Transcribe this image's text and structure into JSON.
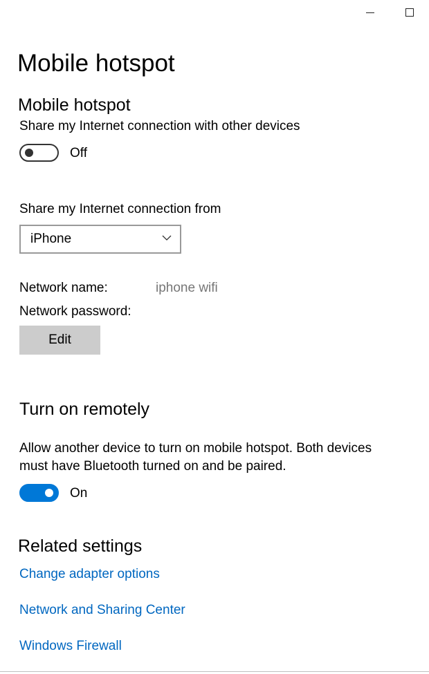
{
  "window": {
    "minimize_icon": "minimize-icon",
    "maximize_icon": "maximize-icon"
  },
  "page": {
    "title": "Mobile hotspot"
  },
  "hotspot": {
    "section_title": "Mobile hotspot",
    "description": "Share my Internet connection with other devices",
    "toggle_state": "Off",
    "toggle_on": false
  },
  "share_from": {
    "label": "Share my Internet connection from",
    "selected": "iPhone"
  },
  "network": {
    "name_label": "Network name:",
    "name_value": "iphone wifi",
    "password_label": "Network password:",
    "password_value": "",
    "edit_label": "Edit"
  },
  "remote": {
    "section_title": "Turn on remotely",
    "description_line1": "Allow another device to turn on mobile hotspot. Both devices",
    "description_line2": "must have Bluetooth turned on and be paired.",
    "toggle_state": "On",
    "toggle_on": true
  },
  "related": {
    "section_title": "Related settings",
    "links": [
      "Change adapter options",
      "Network and Sharing Center",
      "Windows Firewall"
    ]
  },
  "colors": {
    "accent": "#0078d7",
    "link": "#0067c0",
    "button_bg": "#cccccc"
  }
}
